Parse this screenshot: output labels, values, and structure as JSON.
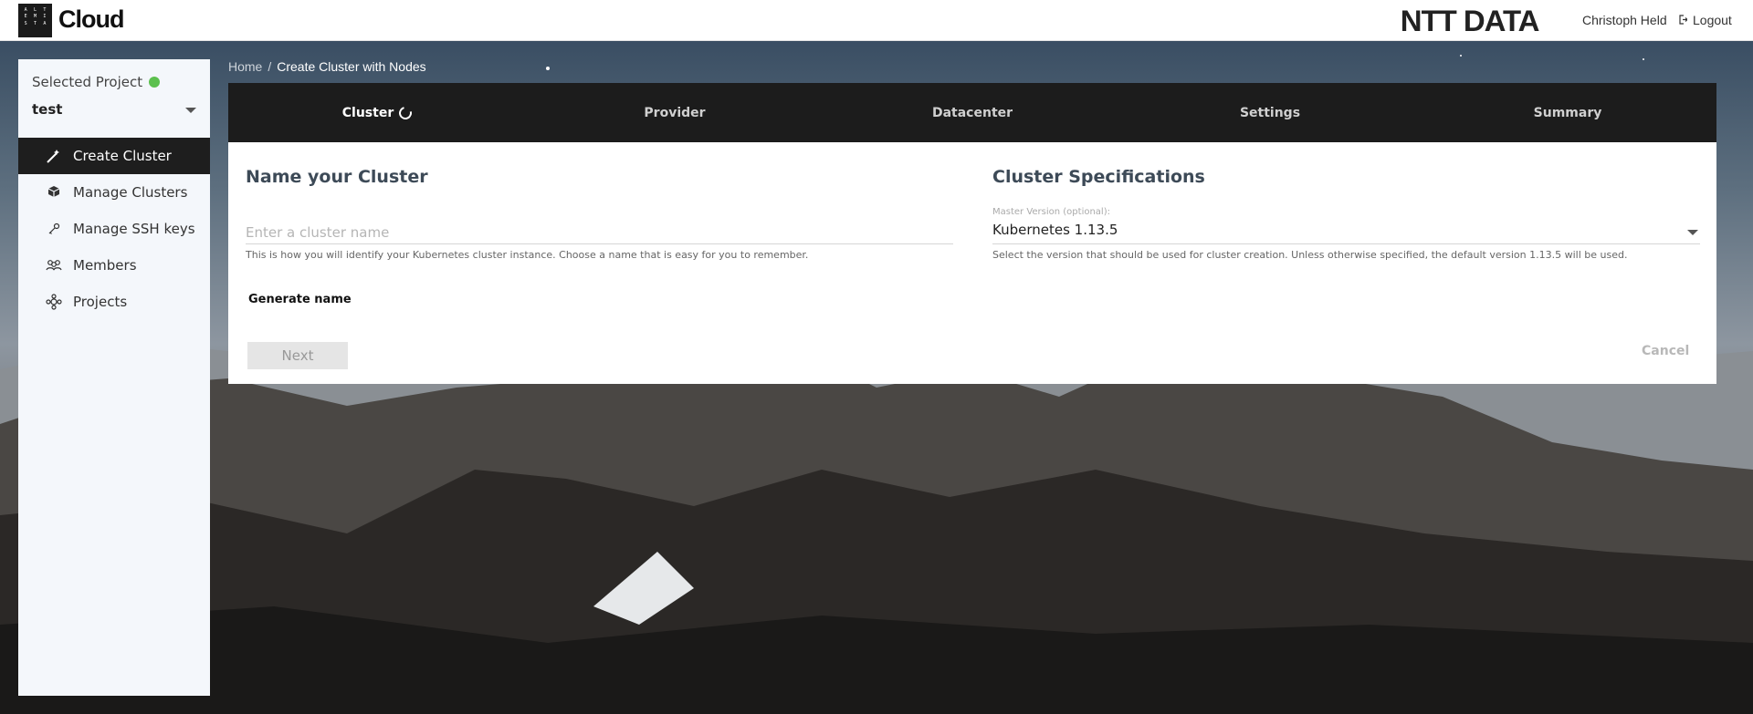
{
  "header": {
    "logo_letters": [
      "A",
      "L",
      "T",
      "E",
      "M",
      "I",
      "S",
      "T",
      "A"
    ],
    "logo_text": "Cloud",
    "brand": "NTT DATA",
    "user_name": "Christoph Held",
    "logout_label": "Logout"
  },
  "sidebar": {
    "project_label": "Selected Project",
    "project_status_color": "#5cc04e",
    "project_value": "test",
    "items": [
      {
        "label": "Create Cluster",
        "icon": "magic-wand-icon",
        "active": true
      },
      {
        "label": "Manage Clusters",
        "icon": "cubes-icon",
        "active": false
      },
      {
        "label": "Manage SSH keys",
        "icon": "key-icon",
        "active": false
      },
      {
        "label": "Members",
        "icon": "users-icon",
        "active": false
      },
      {
        "label": "Projects",
        "icon": "projects-icon",
        "active": false
      }
    ]
  },
  "breadcrumb": {
    "home": "Home",
    "separator": "/",
    "current": "Create Cluster with Nodes"
  },
  "stepper": {
    "steps": [
      {
        "label": "Cluster",
        "active": true
      },
      {
        "label": "Provider",
        "active": false
      },
      {
        "label": "Datacenter",
        "active": false
      },
      {
        "label": "Settings",
        "active": false
      },
      {
        "label": "Summary",
        "active": false
      }
    ]
  },
  "form": {
    "name_title": "Name your Cluster",
    "name_value": "",
    "name_placeholder": "Enter a cluster name",
    "name_hint": "This is how you will identify your Kubernetes cluster instance. Choose a name that is easy for you to remember.",
    "generate_label": "Generate name",
    "spec_title": "Cluster Specifications",
    "master_version_label": "Master Version (optional):",
    "master_version_value": "Kubernetes 1.13.5",
    "master_version_hint": "Select the version that should be used for cluster creation. Unless otherwise specified, the default version 1.13.5 will be used.",
    "next_label": "Next",
    "cancel_label": "Cancel"
  },
  "colors": {
    "accent_dark": "#1c1c1c",
    "active_nav": "#1e1e1e",
    "status_green": "#5cc04e"
  }
}
